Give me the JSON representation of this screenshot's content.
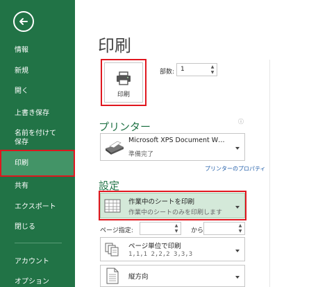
{
  "sidebar": {
    "items": [
      {
        "label": "情報"
      },
      {
        "label": "新規"
      },
      {
        "label": "開く"
      },
      {
        "label": "上書き保存"
      },
      {
        "label": "名前を付けて保存"
      },
      {
        "label": "印刷"
      },
      {
        "label": "共有"
      },
      {
        "label": "エクスポート"
      },
      {
        "label": "閉じる"
      },
      {
        "label": "アカウント"
      },
      {
        "label": "オプション"
      }
    ],
    "selected": "印刷"
  },
  "main": {
    "title": "印刷",
    "print_button": {
      "label": "印刷"
    },
    "copies": {
      "label": "部数:",
      "value": "1"
    },
    "printer": {
      "section_title": "プリンター",
      "name": "Microsoft XPS Document W…",
      "status": "準備完了",
      "properties_link": "プリンターのプロパティ",
      "info_icon": "info-icon"
    },
    "settings": {
      "section_title": "設定",
      "print_what": {
        "title": "作業中のシートを印刷",
        "subtitle": "作業中のシートのみを印刷します"
      },
      "pages": {
        "label": "ページ指定:",
        "to_label": "から",
        "from_value": "",
        "to_value": ""
      },
      "collation": {
        "title": "ページ単位で印刷",
        "subtitle": "1,1,1   2,2,2   3,3,3"
      },
      "orientation": {
        "title": "縦方向"
      }
    }
  },
  "colors": {
    "sidebar_bg": "#217346",
    "sidebar_selected": "#439467",
    "accent_red": "#e0161e",
    "section_green": "#217346"
  }
}
